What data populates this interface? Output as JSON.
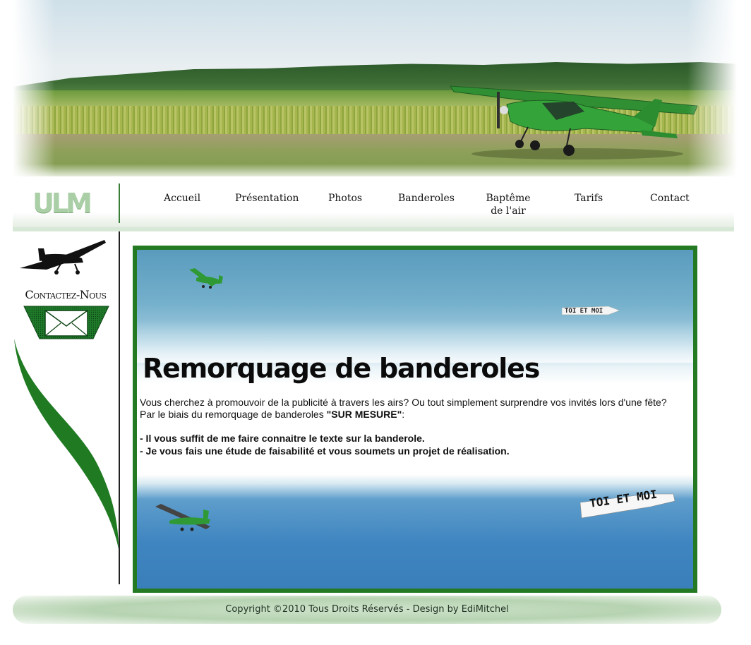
{
  "nav": {
    "logo": "ULM",
    "items": [
      {
        "label": "Accueil"
      },
      {
        "label": "Présentation"
      },
      {
        "label": "Photos"
      },
      {
        "label": "Banderoles"
      },
      {
        "label": "Baptême",
        "label2": "de l'air"
      },
      {
        "label": "Tarifs"
      },
      {
        "label": "Contact"
      }
    ]
  },
  "sidebar": {
    "contact_label": "Contactez-Nous"
  },
  "main": {
    "title": "Remorquage de banderoles",
    "intro_line1": "Vous cherchez à promouvoir de la publicité à travers les airs? Ou tout simplement surprendre vos invités lors d'une fête?",
    "intro_line2_prefix": "Par le biais du remorquage de banderoles ",
    "intro_line2_strong": "\"SUR MESURE\"",
    "intro_line2_suffix": ":",
    "bullets": [
      "- Il vous suffit de me faire connaitre le texte sur la banderole.",
      "- Je vous fais une étude de faisabilité et vous soumets un projet de réalisation."
    ],
    "banner_text_top": "TOI ET MOI",
    "banner_text_bottom": "TOI ET MOI"
  },
  "footer": {
    "copyright": "Copyright ©2010 Tous Droits Réservés - Design by EdiMitchel"
  },
  "colors": {
    "accent_green": "#237a23",
    "plane_green": "#2f9a35"
  },
  "icons": [
    "plane-silhouette-icon",
    "envelope-icon"
  ]
}
